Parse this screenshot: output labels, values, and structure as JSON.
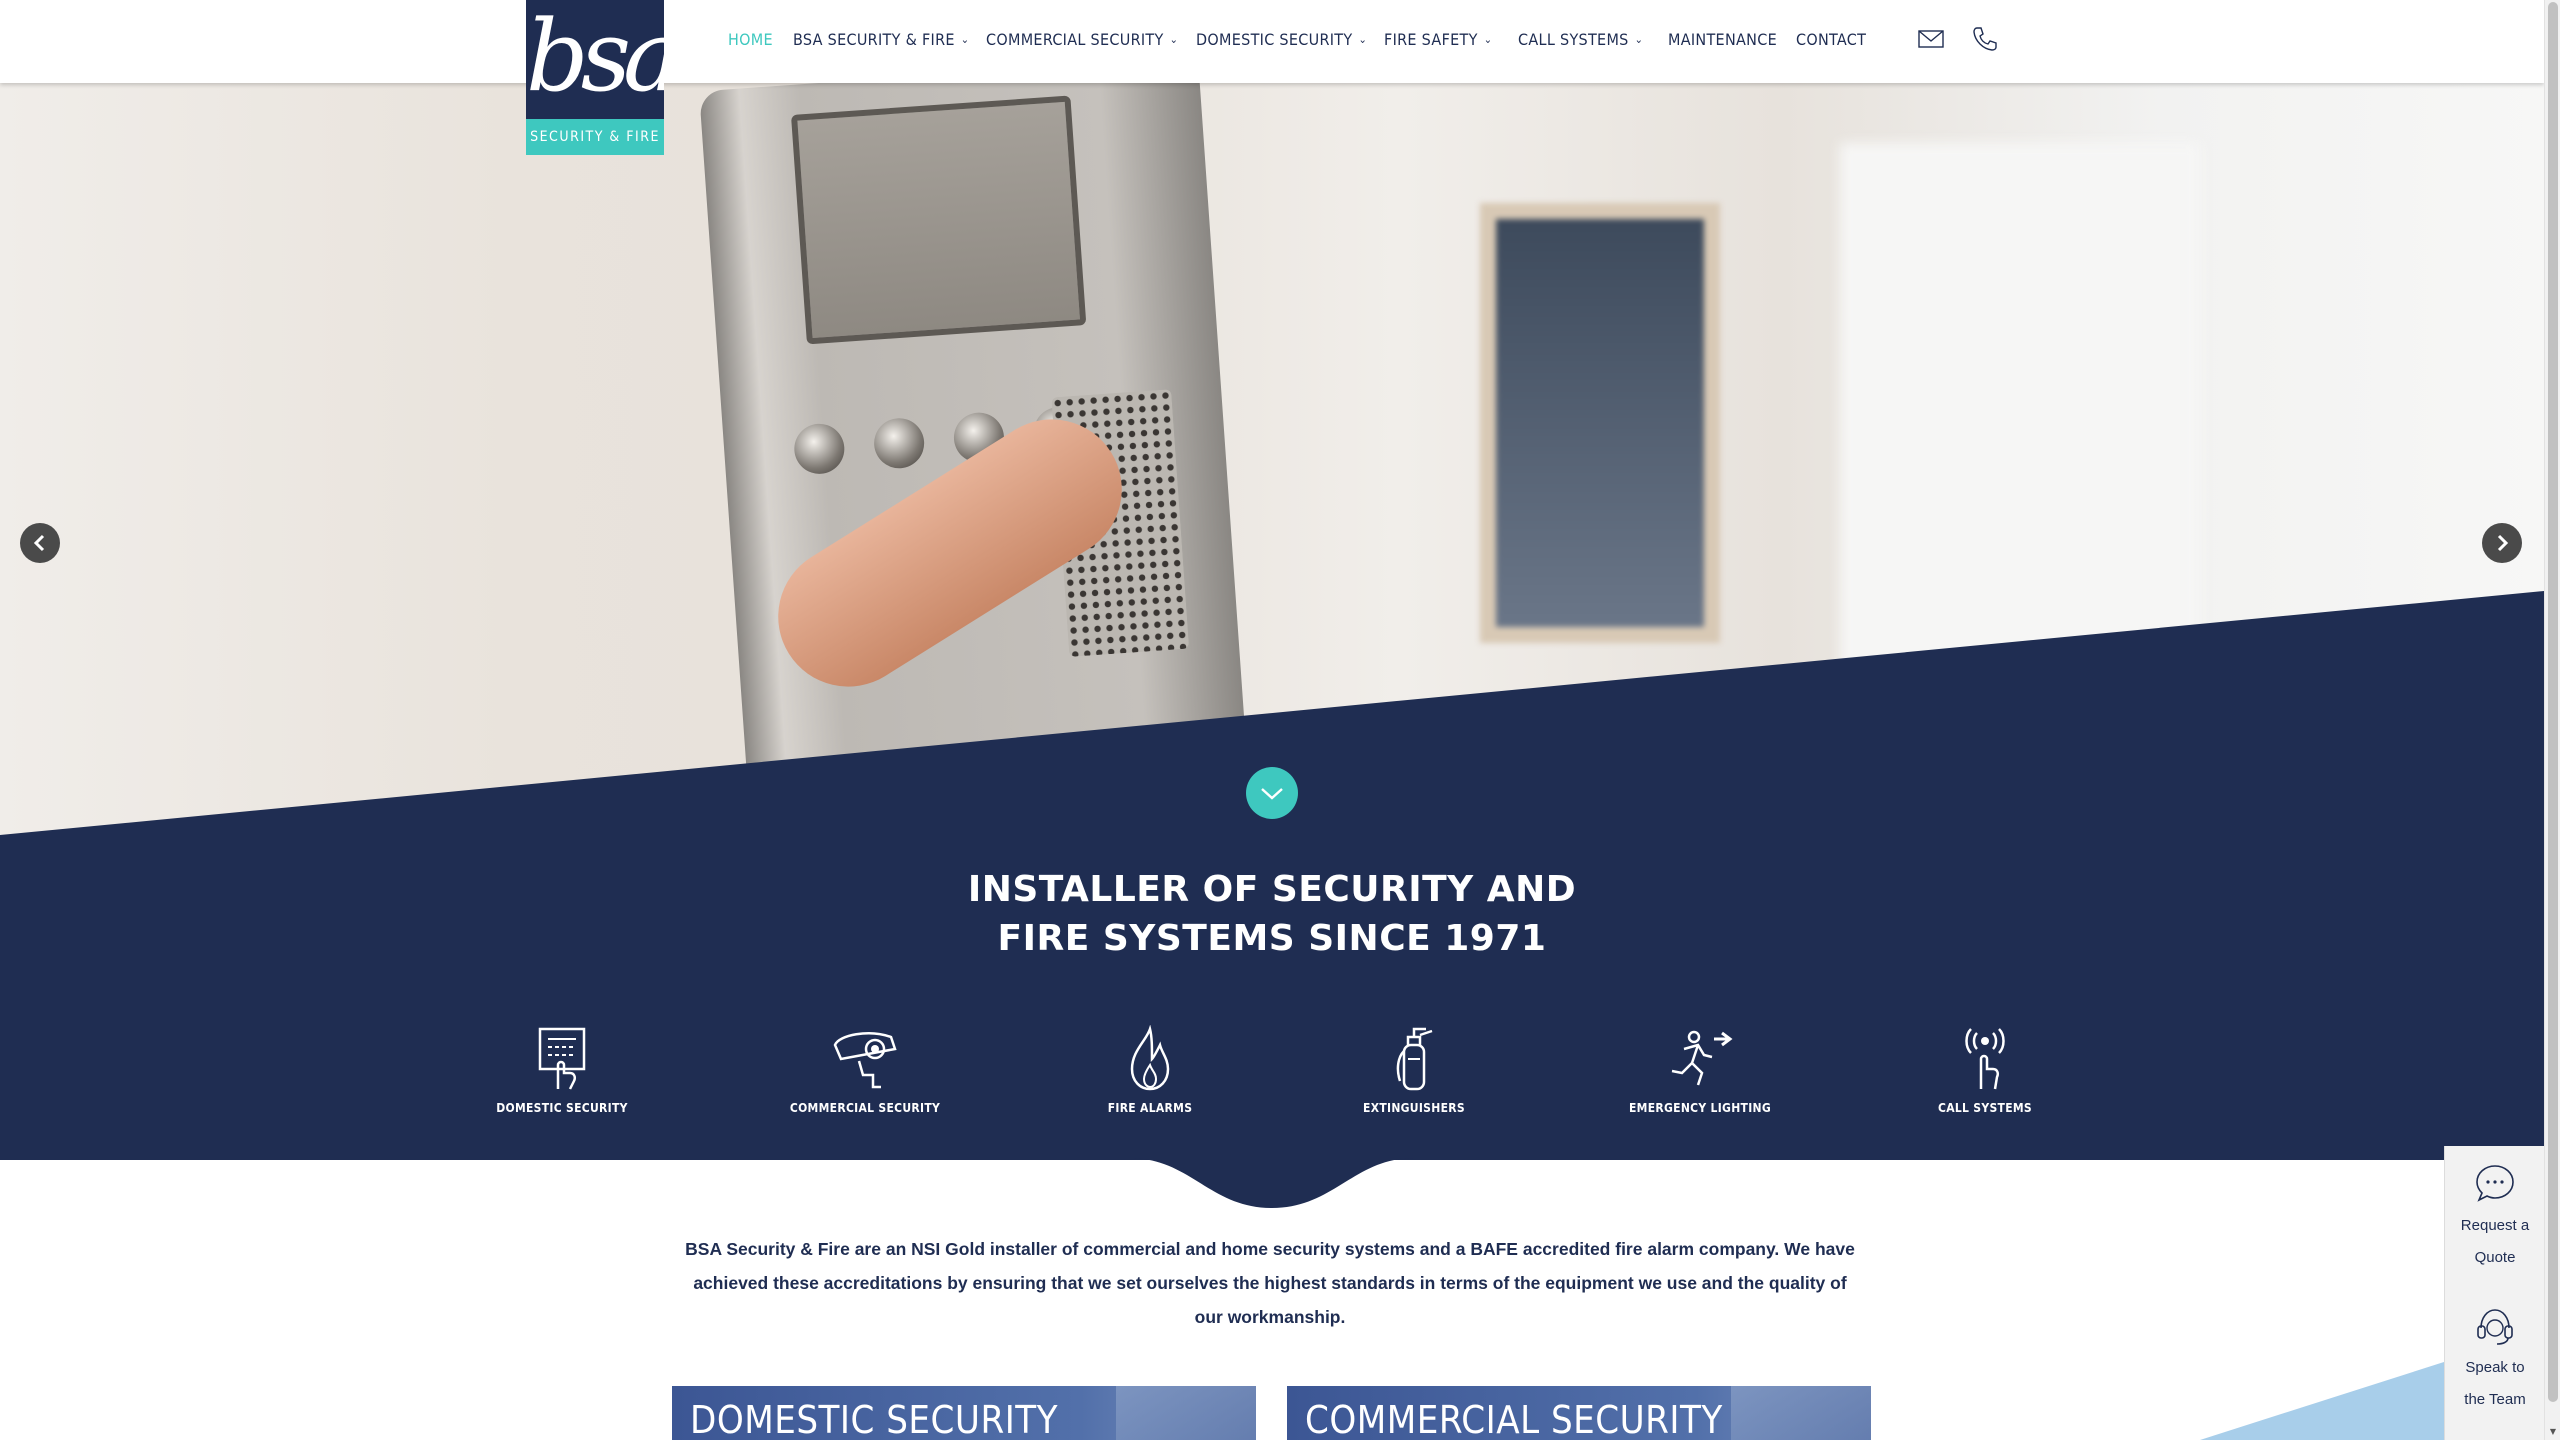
{
  "logo": {
    "mark": "bsa",
    "tagline": "SECURITY & FIRE"
  },
  "nav": {
    "items": [
      {
        "label": "HOME",
        "active": true,
        "dropdown": false
      },
      {
        "label": "BSA SECURITY & FIRE",
        "active": false,
        "dropdown": true
      },
      {
        "label": "COMMERCIAL SECURITY",
        "active": false,
        "dropdown": true
      },
      {
        "label": "DOMESTIC SECURITY",
        "active": false,
        "dropdown": true
      },
      {
        "label": "FIRE SAFETY",
        "active": false,
        "dropdown": true
      },
      {
        "label": "CALL SYSTEMS",
        "active": false,
        "dropdown": true
      },
      {
        "label": "MAINTENANCE",
        "active": false,
        "dropdown": false
      },
      {
        "label": "CONTACT",
        "active": false,
        "dropdown": false
      }
    ],
    "icons": [
      "envelope-icon",
      "phone-icon"
    ]
  },
  "hero": {
    "prev_icon": "chevron-left-icon",
    "next_icon": "chevron-right-icon",
    "scroll_icon": "chevron-down-icon"
  },
  "headline": {
    "line1": "INSTALLER OF SECURITY AND",
    "line2": "FIRE SYSTEMS SINCE 1971"
  },
  "services": [
    {
      "label": "DOMESTIC SECURITY",
      "icon": "keypad-icon"
    },
    {
      "label": "COMMERCIAL SECURITY",
      "icon": "cctv-camera-icon"
    },
    {
      "label": "FIRE ALARMS",
      "icon": "flame-icon"
    },
    {
      "label": "EXTINGUISHERS",
      "icon": "fire-extinguisher-icon"
    },
    {
      "label": "EMERGENCY LIGHTING",
      "icon": "emergency-exit-icon"
    },
    {
      "label": "CALL SYSTEMS",
      "icon": "call-signal-icon"
    }
  ],
  "intro": "BSA Security & Fire are an NSI Gold installer of commercial and home security systems and a BAFE accredited fire alarm company. We have achieved these accreditations by ensuring that we set ourselves the highest standards in terms of the equipment we use and the quality of our workmanship.",
  "cards": [
    {
      "title": "DOMESTIC SECURITY"
    },
    {
      "title": "COMMERCIAL SECURITY"
    }
  ],
  "widget": {
    "quote": {
      "line1": "Request a",
      "line2": "Quote",
      "icon": "chat-bubble-icon"
    },
    "speak": {
      "line1": "Speak to",
      "line2": "the Team",
      "icon": "headset-icon"
    }
  },
  "colors": {
    "navy": "#1f2d52",
    "teal": "#3ec8bf",
    "white": "#ffffff"
  }
}
